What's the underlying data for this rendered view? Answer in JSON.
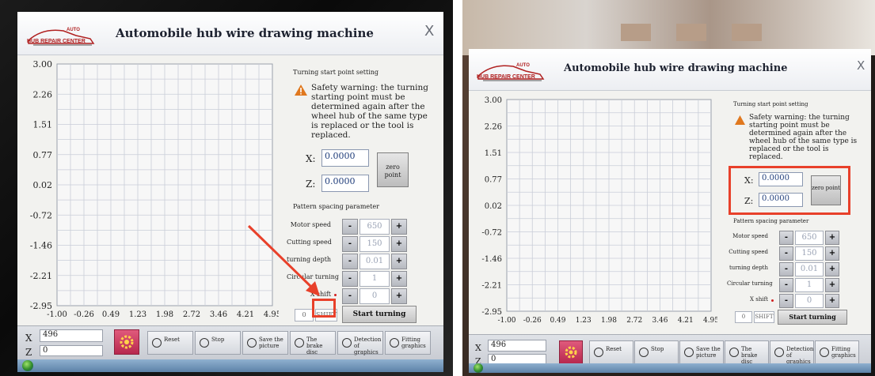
{
  "app": {
    "title": "Automobile hub wire drawing machine",
    "logo_text": "HUB REPAIR CENTER",
    "logo_auto": "AUTO",
    "close_glyph": "X"
  },
  "plot": {
    "y_ticks": [
      "3.00",
      "2.26",
      "1.51",
      "0.77",
      "0.02",
      "-0.72",
      "-1.46",
      "-2.21",
      "-2.95"
    ],
    "x_ticks": [
      "-1.00",
      "-0.26",
      "0.49",
      "1.23",
      "1.98",
      "2.72",
      "3.46",
      "4.21",
      "4.95"
    ],
    "grid": true,
    "grid_color": "#c9cdd8",
    "background": "#f7f7f7"
  },
  "turning_setting": {
    "title": "Turning start point setting",
    "warning": "Safety warning: the turning starting point must be determined again after the wheel hub of the same type is replaced or the tool is replaced.",
    "warning_icon": "warning-triangle-icon",
    "x_label": "X:",
    "z_label": "Z:",
    "x_value": "0.0000",
    "z_value": "0.0000",
    "zero_button": "zero point"
  },
  "pattern": {
    "title": "Pattern spacing parameter",
    "rows": [
      {
        "label": "Motor speed",
        "value": "650"
      },
      {
        "label": "Cutting speed",
        "value": "150"
      },
      {
        "label": "turning depth",
        "value": "0.01"
      },
      {
        "label": "Circular turning",
        "value": "1"
      },
      {
        "label": "X shift",
        "value": "0"
      }
    ],
    "minus": "-",
    "plus": "+",
    "small_value": "0",
    "shift_button": "SHIFT",
    "start_button": "Start turning"
  },
  "readout": {
    "x_label": "X",
    "x_value": "496",
    "z_label": "Z",
    "z_value": "0"
  },
  "toolbar": [
    {
      "label": "Reset",
      "icon": "reset-icon"
    },
    {
      "label": "Stop",
      "icon": "stop-icon"
    },
    {
      "label": "Save the picture",
      "icon": "save-icon"
    },
    {
      "label": "The brake disc",
      "icon": "brake-disc-icon"
    },
    {
      "label": "Detection of graphics",
      "icon": "detection-icon"
    },
    {
      "label": "Fitting graphics",
      "icon": "fitting-icon"
    }
  ],
  "colors": {
    "annotation_red": "#e8402a",
    "gear_button": "#c7345a",
    "warning_orange": "#e0781e"
  }
}
